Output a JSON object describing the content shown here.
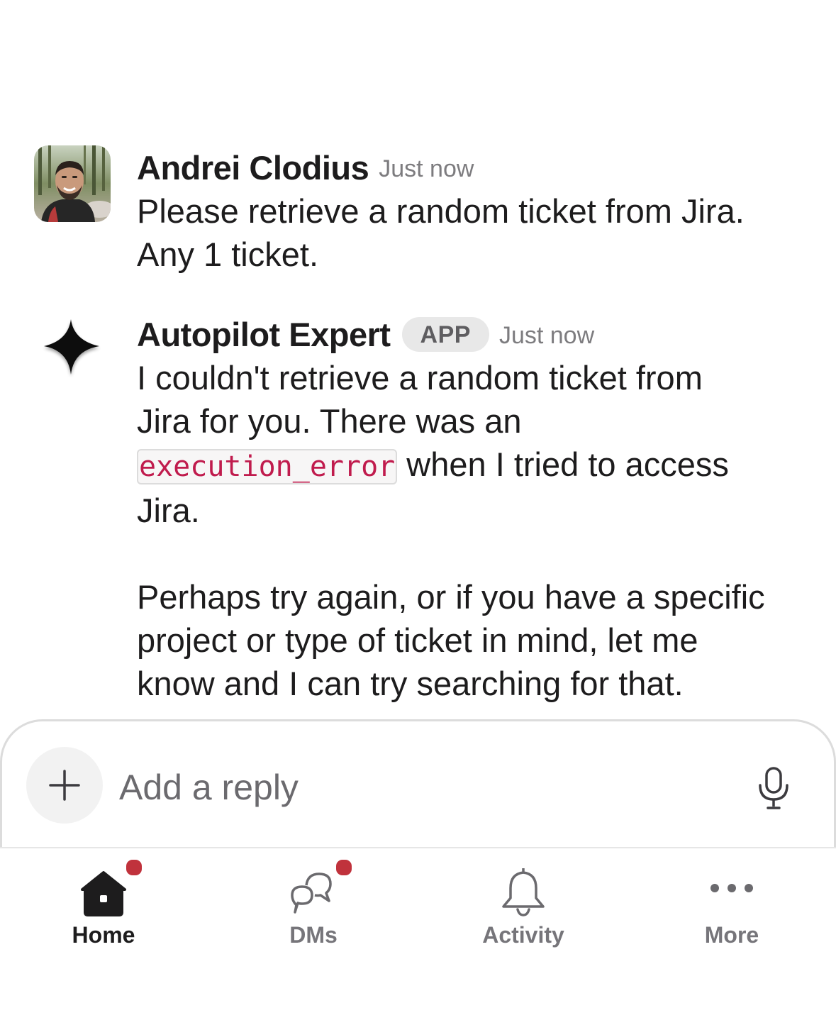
{
  "messages": [
    {
      "sender": "Andrei Clodius",
      "timestamp": "Just now",
      "avatar": "user-photo-avatar",
      "text_lines": [
        "Please retrieve a random ticket from Jira.",
        "Any 1 ticket."
      ]
    },
    {
      "sender": "Autopilot Expert",
      "badge": "APP",
      "timestamp": "Just now",
      "avatar": "sparkle-icon",
      "line1": "I couldn't retrieve a random ticket from",
      "line2": "Jira for you. There was an",
      "code": "execution_error",
      "line3_after_code": " when I tried to access",
      "line4": "Jira.",
      "para2_lines": [
        "Perhaps try again, or if you have a specific",
        "project or type of ticket in mind, let me",
        "know and I can try searching for that."
      ]
    }
  ],
  "composer": {
    "placeholder": "Add a reply",
    "add_icon": "plus-icon",
    "mic_icon": "microphone-icon"
  },
  "tabs": [
    {
      "label": "Home",
      "icon": "home-icon",
      "active": true,
      "has_notification": true
    },
    {
      "label": "DMs",
      "icon": "dms-icon",
      "active": false,
      "has_notification": true
    },
    {
      "label": "Activity",
      "icon": "bell-icon",
      "active": false,
      "has_notification": false
    },
    {
      "label": "More",
      "icon": "more-icon",
      "active": false,
      "has_notification": false
    }
  ],
  "colors": {
    "notification_dot": "#c0323c",
    "code_text": "#c01b4d",
    "text": "#1d1c1d",
    "muted": "#76757a"
  }
}
